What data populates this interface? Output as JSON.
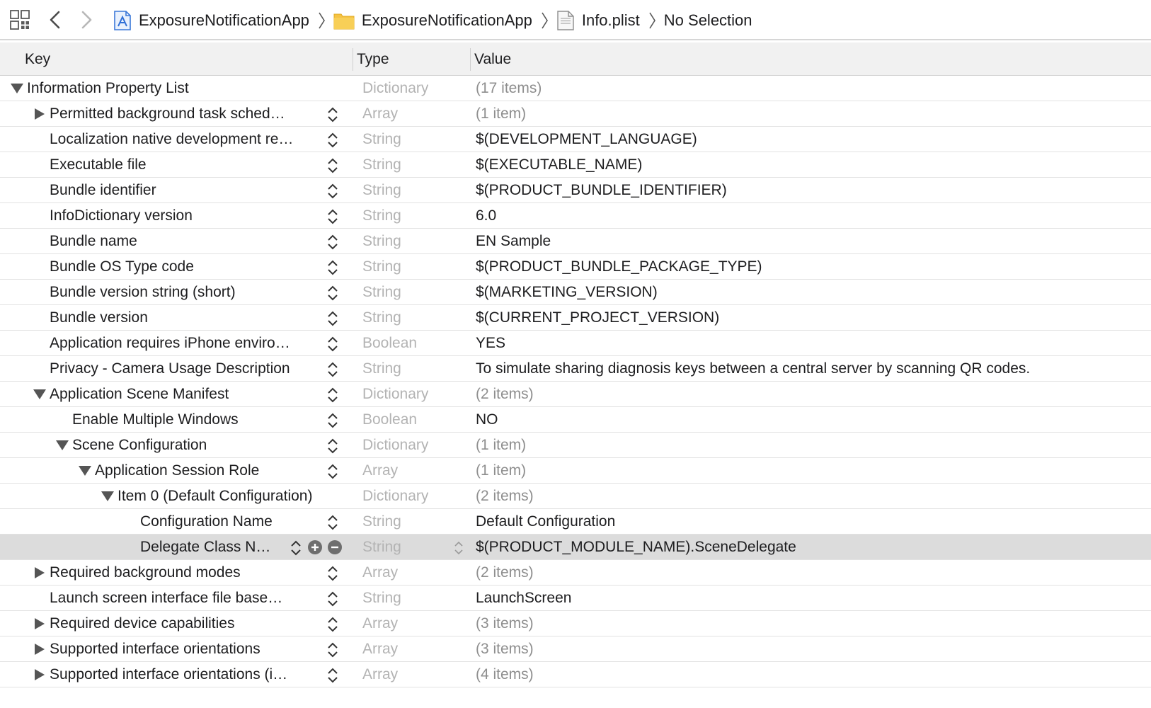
{
  "breadcrumbs": [
    {
      "label": "ExposureNotificationApp",
      "icon": "xcode-project-icon"
    },
    {
      "label": "ExposureNotificationApp",
      "icon": "folder-icon"
    },
    {
      "label": "Info.plist",
      "icon": "plist-file-icon"
    },
    {
      "label": "No Selection",
      "icon": ""
    }
  ],
  "columns": {
    "key": "Key",
    "type": "Type",
    "value": "Value"
  },
  "rows": [
    {
      "key": "Information Property List",
      "type": "Dictionary",
      "value": "(17 items)",
      "level": 0,
      "disclosure": "open",
      "muted": true,
      "stepper": false
    },
    {
      "key": "Permitted background task sched…",
      "type": "Array",
      "value": "(1 item)",
      "level": 1,
      "disclosure": "closed",
      "muted": true,
      "stepper": true
    },
    {
      "key": "Localization native development re…",
      "type": "String",
      "value": "$(DEVELOPMENT_LANGUAGE)",
      "level": 1,
      "disclosure": "none",
      "muted": false,
      "stepper": true
    },
    {
      "key": "Executable file",
      "type": "String",
      "value": "$(EXECUTABLE_NAME)",
      "level": 1,
      "disclosure": "none",
      "muted": false,
      "stepper": true
    },
    {
      "key": "Bundle identifier",
      "type": "String",
      "value": "$(PRODUCT_BUNDLE_IDENTIFIER)",
      "level": 1,
      "disclosure": "none",
      "muted": false,
      "stepper": true
    },
    {
      "key": "InfoDictionary version",
      "type": "String",
      "value": "6.0",
      "level": 1,
      "disclosure": "none",
      "muted": false,
      "stepper": true
    },
    {
      "key": "Bundle name",
      "type": "String",
      "value": "EN Sample",
      "level": 1,
      "disclosure": "none",
      "muted": false,
      "stepper": true
    },
    {
      "key": "Bundle OS Type code",
      "type": "String",
      "value": "$(PRODUCT_BUNDLE_PACKAGE_TYPE)",
      "level": 1,
      "disclosure": "none",
      "muted": false,
      "stepper": true
    },
    {
      "key": "Bundle version string (short)",
      "type": "String",
      "value": "$(MARKETING_VERSION)",
      "level": 1,
      "disclosure": "none",
      "muted": false,
      "stepper": true
    },
    {
      "key": "Bundle version",
      "type": "String",
      "value": "$(CURRENT_PROJECT_VERSION)",
      "level": 1,
      "disclosure": "none",
      "muted": false,
      "stepper": true
    },
    {
      "key": "Application requires iPhone enviro…",
      "type": "Boolean",
      "value": "YES",
      "level": 1,
      "disclosure": "none",
      "muted": false,
      "stepper": true
    },
    {
      "key": "Privacy - Camera Usage Description",
      "type": "String",
      "value": "To simulate sharing diagnosis keys between a central server by scanning QR codes.",
      "level": 1,
      "disclosure": "none",
      "muted": false,
      "stepper": true
    },
    {
      "key": "Application Scene Manifest",
      "type": "Dictionary",
      "value": "(2 items)",
      "level": 1,
      "disclosure": "open",
      "muted": true,
      "stepper": true
    },
    {
      "key": "Enable Multiple Windows",
      "type": "Boolean",
      "value": "NO",
      "level": 2,
      "disclosure": "none",
      "muted": false,
      "stepper": true
    },
    {
      "key": "Scene Configuration",
      "type": "Dictionary",
      "value": "(1 item)",
      "level": 2,
      "disclosure": "open",
      "muted": true,
      "stepper": true
    },
    {
      "key": "Application Session Role",
      "type": "Array",
      "value": "(1 item)",
      "level": 3,
      "disclosure": "open",
      "muted": true,
      "stepper": true
    },
    {
      "key": "Item 0 (Default Configuration)",
      "type": "Dictionary",
      "value": "(2 items)",
      "level": 4,
      "disclosure": "open",
      "muted": true,
      "stepper": false
    },
    {
      "key": "Configuration Name",
      "type": "String",
      "value": "Default Configuration",
      "level": 5,
      "disclosure": "none",
      "muted": false,
      "stepper": true
    },
    {
      "key": "Delegate Class N…",
      "type": "String",
      "value": "$(PRODUCT_MODULE_NAME).SceneDelegate",
      "level": 5,
      "disclosure": "none",
      "muted": false,
      "stepper": true,
      "selected": true
    },
    {
      "key": "Required background modes",
      "type": "Array",
      "value": "(2 items)",
      "level": 1,
      "disclosure": "closed",
      "muted": true,
      "stepper": true
    },
    {
      "key": "Launch screen interface file base…",
      "type": "String",
      "value": "LaunchScreen",
      "level": 1,
      "disclosure": "none",
      "muted": false,
      "stepper": true
    },
    {
      "key": "Required device capabilities",
      "type": "Array",
      "value": "(3 items)",
      "level": 1,
      "disclosure": "closed",
      "muted": true,
      "stepper": true
    },
    {
      "key": "Supported interface orientations",
      "type": "Array",
      "value": "(3 items)",
      "level": 1,
      "disclosure": "closed",
      "muted": true,
      "stepper": true
    },
    {
      "key": "Supported interface orientations (i…",
      "type": "Array",
      "value": "(4 items)",
      "level": 1,
      "disclosure": "closed",
      "muted": true,
      "stepper": true
    }
  ]
}
